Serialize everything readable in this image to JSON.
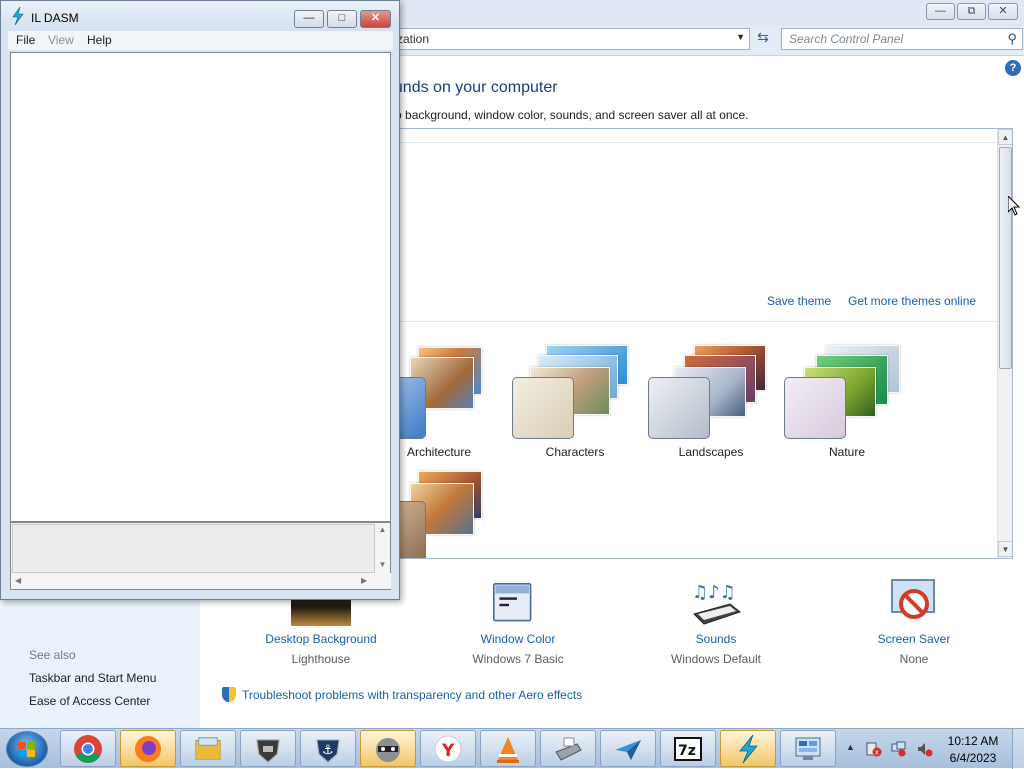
{
  "control_panel": {
    "address_fragment": "zation",
    "search_placeholder": "Search Control Panel",
    "heading_fragment": "ounds on your computer",
    "subtext_fragment": "top background, window color, sounds, and screen saver all at once.",
    "save_theme": "Save theme",
    "get_more_themes": "Get more themes online",
    "themes": [
      {
        "label": "Architecture"
      },
      {
        "label": "Characters"
      },
      {
        "label": "Landscapes"
      },
      {
        "label": "Nature"
      }
    ],
    "bottom": [
      {
        "title": "Desktop Background",
        "sub": "Lighthouse",
        "icon": "desktop-background-icon"
      },
      {
        "title": "Window Color",
        "sub": "Windows 7 Basic",
        "icon": "window-color-icon"
      },
      {
        "title": "Sounds",
        "sub": "Windows Default",
        "icon": "sounds-icon"
      },
      {
        "title": "Screen Saver",
        "sub": "None",
        "icon": "screen-saver-icon"
      }
    ],
    "troubleshoot": "Troubleshoot problems with transparency and other Aero effects",
    "see_also": {
      "title": "See also",
      "links": [
        "Taskbar and Start Menu",
        "Ease of Access Center"
      ]
    }
  },
  "ildasm": {
    "title": "IL DASM",
    "menu": [
      "File",
      "View",
      "Help"
    ]
  },
  "taskbar": {
    "time": "10:12 AM",
    "date": "6/4/2023",
    "apps": [
      "chrome-icon",
      "firefox-icon",
      "file-explorer-icon",
      "world-of-tanks-icon",
      "world-of-warships-icon",
      "raccoon-app-icon",
      "yandex-browser-icon",
      "vlc-icon",
      "scanner-icon",
      "paper-plane-app-icon",
      "7zip-icon",
      "ildasm-icon",
      "control-panel-icon"
    ]
  },
  "colors": {
    "link": "#1a5eb3",
    "heading": "#1e3a8a",
    "taskbar": "#b6cbe3",
    "close_red": "#c8453c"
  }
}
